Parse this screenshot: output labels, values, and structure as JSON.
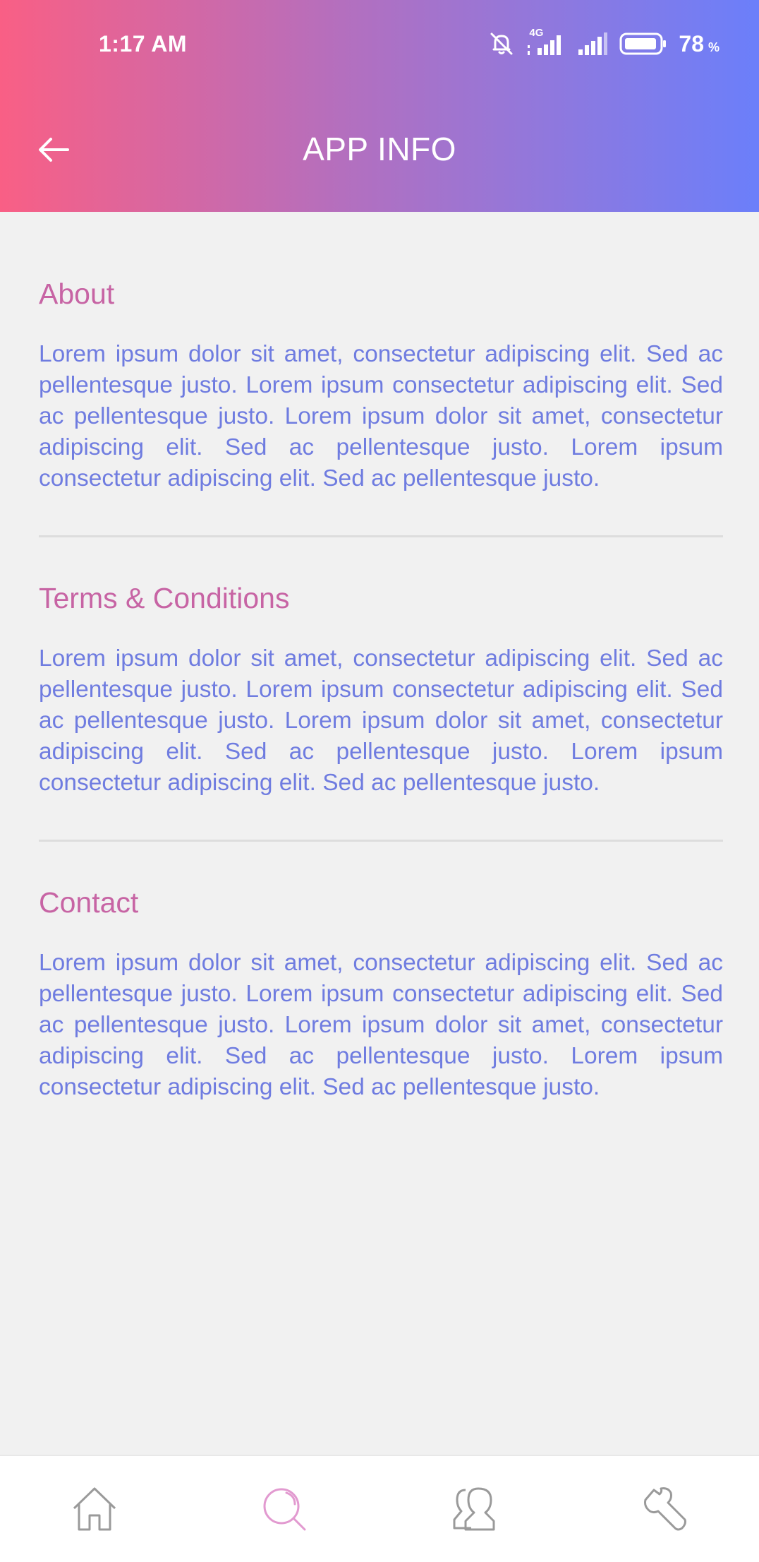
{
  "status_bar": {
    "time": "1:17 AM",
    "battery_percent": "78",
    "battery_unit": "%",
    "network_label": "4G",
    "icons": [
      "mute-icon",
      "signal-4g-icon",
      "signal-icon",
      "battery-icon"
    ]
  },
  "header": {
    "title": "APP INFO",
    "back_icon": "arrow-left-icon",
    "gradient_colors": [
      "#f95f85",
      "#6b7ffa"
    ]
  },
  "sections": [
    {
      "title": "About",
      "body": "Lorem ipsum dolor sit amet, consectetur adipiscing elit. Sed ac pellentesque justo. Lorem ipsum consectetur adipiscing elit. Sed ac pellentesque justo. Lorem ipsum dolor sit amet, consectetur adipiscing elit. Sed ac pellentesque justo. Lorem ipsum consectetur adipiscing elit. Sed ac pellentesque justo."
    },
    {
      "title": "Terms & Conditions",
      "body": "Lorem ipsum dolor sit amet, consectetur adipiscing elit. Sed ac pellentesque justo. Lorem ipsum consectetur adipiscing elit. Sed ac pellentesque justo. Lorem ipsum dolor sit amet, consectetur adipiscing elit. Sed ac pellentesque justo. Lorem ipsum consectetur adipiscing elit. Sed ac pellentesque justo."
    },
    {
      "title": "Contact",
      "body": "Lorem ipsum dolor sit amet, consectetur adipiscing elit. Sed ac pellentesque justo. Lorem ipsum consectetur adipiscing elit. Sed ac pellentesque justo. Lorem ipsum dolor sit amet, consectetur adipiscing elit. Sed ac pellentesque justo. Lorem ipsum consectetur adipiscing elit. Sed ac pellentesque justo."
    }
  ],
  "bottom_nav": {
    "items": [
      {
        "icon": "home-icon",
        "active": false
      },
      {
        "icon": "search-icon",
        "active": true
      },
      {
        "icon": "users-icon",
        "active": false
      },
      {
        "icon": "wrench-icon",
        "active": false
      }
    ]
  },
  "colors": {
    "section_title": "#c764a4",
    "section_body": "#6f7ce0",
    "nav_active": "#e29ad0",
    "nav_inactive": "#9a9a9a"
  }
}
